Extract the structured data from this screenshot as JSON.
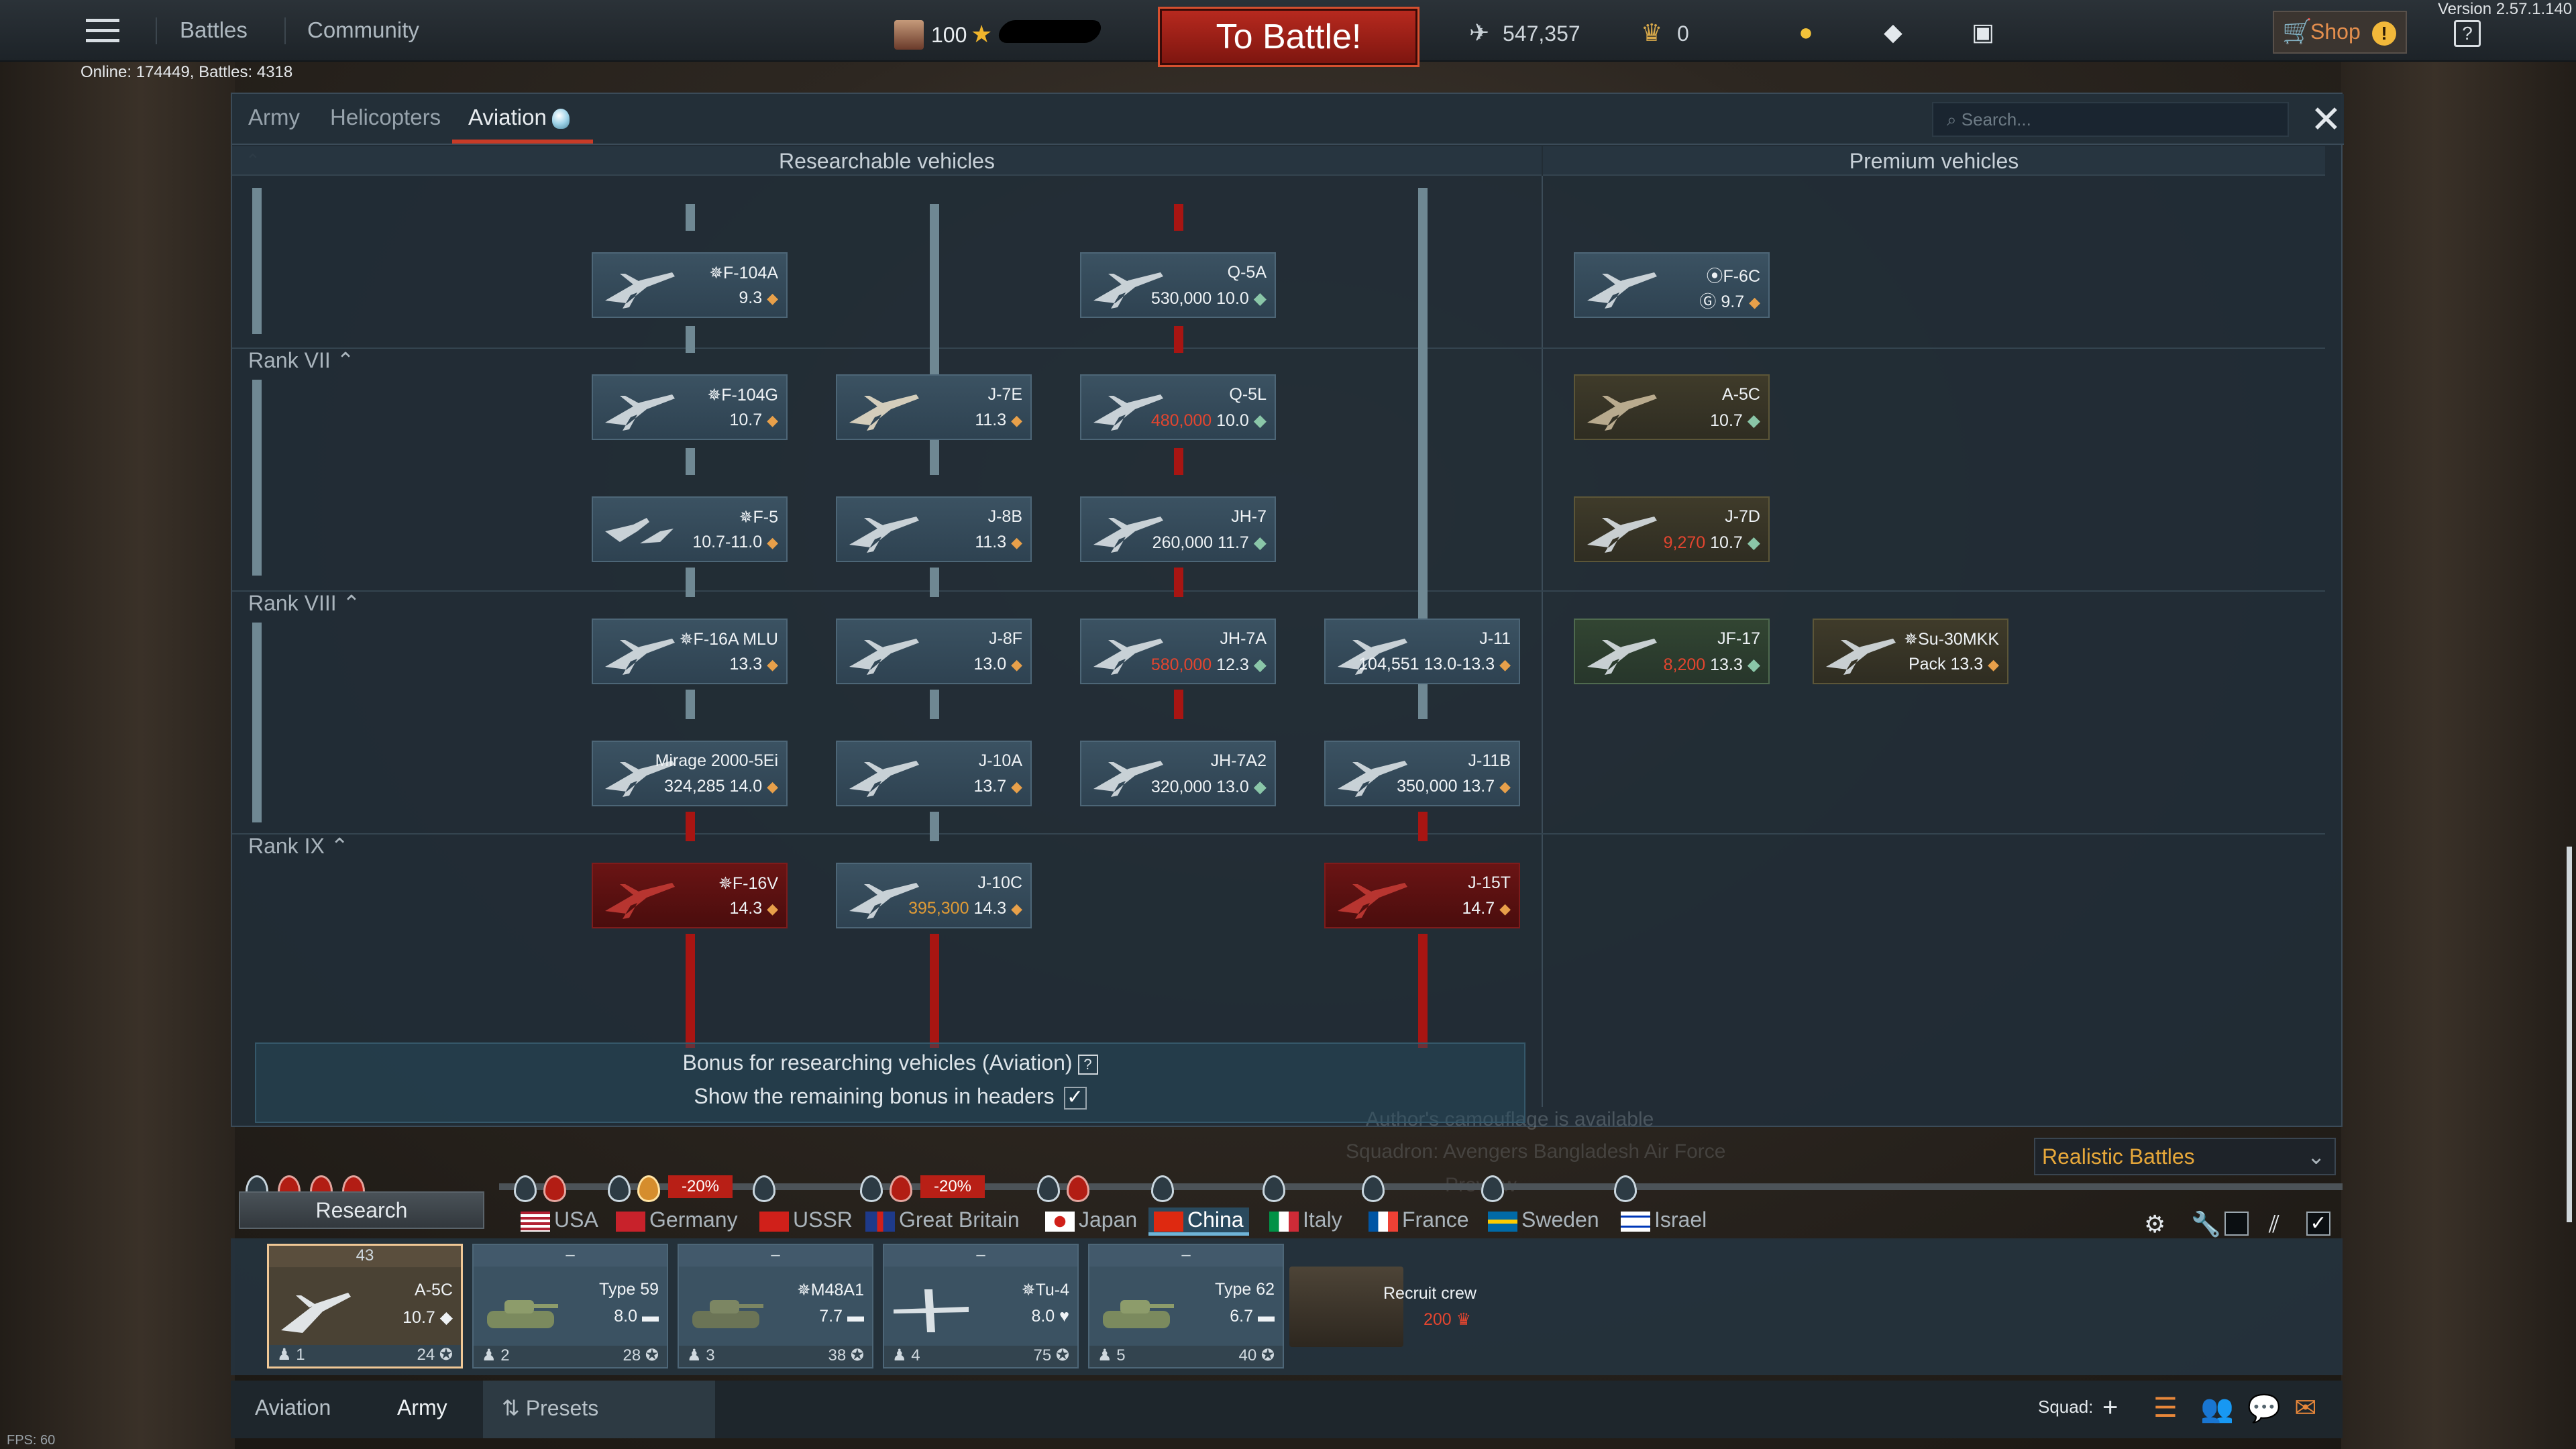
{
  "app": {
    "version": "Version 2.57.1.140",
    "online": "Online: 174449, Battles: 4318",
    "fps": "FPS: 60"
  },
  "topbar": {
    "battles": "Battles",
    "community": "Community",
    "level": "100",
    "to_battle": "To Battle!",
    "silver": "547,357",
    "gold": "0",
    "shop": "Shop"
  },
  "tabs": {
    "army": "Army",
    "helicopters": "Helicopters",
    "aviation": "Aviation",
    "search_placeholder": "Search..."
  },
  "columns": {
    "researchable": "Researchable vehicles",
    "premium": "Premium vehicles"
  },
  "ranks": {
    "vii": "Rank VII",
    "viii": "Rank VIII",
    "ix": "Rank IX"
  },
  "vehicles": {
    "f104a": {
      "name": "✵F-104A",
      "br": "9.3"
    },
    "q5a": {
      "name": "Q-5A",
      "cost": "530,000",
      "br": "10.0"
    },
    "f6c": {
      "name": "⦿F-6C",
      "br": "9.7"
    },
    "f104g": {
      "name": "✵F-104G",
      "br": "10.7"
    },
    "j7e": {
      "name": "J-7E",
      "br": "11.3"
    },
    "q5l": {
      "name": "Q-5L",
      "cost": "480,000",
      "br": "10.0"
    },
    "a5c": {
      "name": "A-5C",
      "br": "10.7"
    },
    "f5": {
      "name": "✵F-5",
      "br": "10.7-11.0"
    },
    "j8b": {
      "name": "J-8B",
      "br": "11.3"
    },
    "jh7": {
      "name": "JH-7",
      "cost": "260,000",
      "br": "11.7"
    },
    "j7d": {
      "name": "J-7D",
      "cost": "9,270",
      "br": "10.7"
    },
    "f16amlu": {
      "name": "✵F-16A MLU",
      "br": "13.3"
    },
    "j8f": {
      "name": "J-8F",
      "br": "13.0"
    },
    "jh7a": {
      "name": "JH-7A",
      "cost": "580,000",
      "br": "12.3"
    },
    "j11": {
      "name": "J-11",
      "cost": "104,551",
      "br": "13.0-13.3"
    },
    "jf17": {
      "name": "JF-17",
      "cost": "8,200",
      "br": "13.3"
    },
    "su30mkk": {
      "name": "✵Su-30MKK",
      "br": "Pack 13.3"
    },
    "mirage": {
      "name": "Mirage 2000-5Ei",
      "cost": "324,285",
      "br": "14.0"
    },
    "j10a": {
      "name": "J-10A",
      "br": "13.7"
    },
    "jh7a2": {
      "name": "JH-7A2",
      "cost": "320,000",
      "br": "13.0"
    },
    "j11b": {
      "name": "J-11B",
      "cost": "350,000",
      "br": "13.7"
    },
    "f16v": {
      "name": "✵F-16V",
      "br": "14.3"
    },
    "j10c": {
      "name": "J-10C",
      "cost": "395,300",
      "br": "14.3"
    },
    "j15t": {
      "name": "J-15T",
      "br": "14.7"
    }
  },
  "bonus": {
    "title": "Bonus for researching vehicles (Aviation)",
    "show": "Show the remaining bonus in headers",
    "camo": "Author's camouflage is available",
    "squadron": "Squadron: Avengers Bangladesh Air Force",
    "preview": "Preview"
  },
  "mode": "Realistic Battles",
  "research": "Research",
  "nations": {
    "usa": "USA",
    "germany": "Germany",
    "ussr": "USSR",
    "gb": "Great Britain",
    "japan": "Japan",
    "china": "China",
    "italy": "Italy",
    "france": "France",
    "sweden": "Sweden",
    "israel": "Israel"
  },
  "discounts": {
    "germany": "-20%",
    "gb": "-20%"
  },
  "crew": [
    {
      "top": "43",
      "name": "A-5C",
      "br": "10.7",
      "n": "1",
      "pts": "24"
    },
    {
      "top": "–",
      "name": "Type 59",
      "br": "8.0",
      "n": "2",
      "pts": "28"
    },
    {
      "top": "–",
      "name": "✵M48A1",
      "br": "7.7",
      "n": "3",
      "pts": "38"
    },
    {
      "top": "–",
      "name": "✵Tu-4",
      "br": "8.0",
      "n": "4",
      "pts": "75"
    },
    {
      "top": "–",
      "name": "Type 62",
      "br": "6.7",
      "n": "5",
      "pts": "40"
    }
  ],
  "recruit": {
    "label": "Recruit crew",
    "cost": "200"
  },
  "bottom": {
    "aviation": "Aviation",
    "army": "Army",
    "presets": "Presets",
    "squad": "Squad:"
  }
}
